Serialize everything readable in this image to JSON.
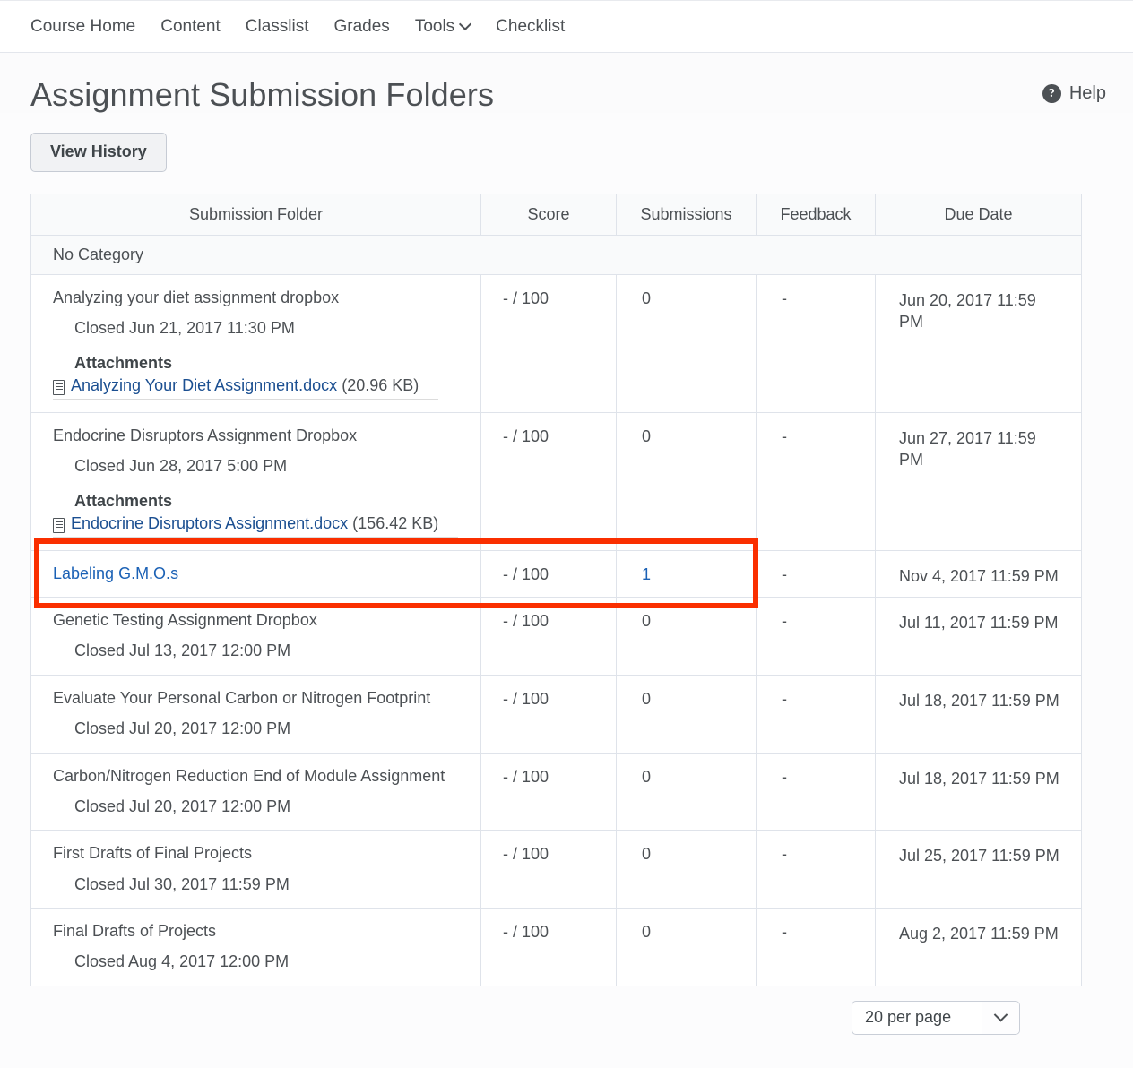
{
  "nav": {
    "items": [
      {
        "label": "Course Home",
        "has_caret": false
      },
      {
        "label": "Content",
        "has_caret": false
      },
      {
        "label": "Classlist",
        "has_caret": false
      },
      {
        "label": "Grades",
        "has_caret": false
      },
      {
        "label": "Tools",
        "has_caret": true
      },
      {
        "label": "Checklist",
        "has_caret": false
      }
    ]
  },
  "header": {
    "title": "Assignment Submission Folders",
    "help_label": "Help",
    "help_icon": "question-circle-icon"
  },
  "toolbar": {
    "view_history_label": "View History"
  },
  "table": {
    "columns": [
      "Submission Folder",
      "Score",
      "Submissions",
      "Feedback",
      "Due Date"
    ],
    "category_label": "No Category",
    "rows": [
      {
        "title": "Analyzing your diet assignment dropbox",
        "is_link": false,
        "closed": "Closed Jun 21, 2017 11:30 PM",
        "attachments_label": "Attachments",
        "attachment_name": "Analyzing Your Diet Assignment.docx",
        "attachment_size": "(20.96 KB)",
        "score": "- / 100",
        "submissions": "0",
        "submissions_is_link": false,
        "feedback": "-",
        "due_date": "Jun 20, 2017 11:59 PM"
      },
      {
        "title": "Endocrine Disruptors Assignment Dropbox",
        "is_link": false,
        "closed": "Closed Jun 28, 2017 5:00 PM",
        "attachments_label": "Attachments",
        "attachment_name": "Endocrine Disruptors Assignment.docx",
        "attachment_size": "(156.42 KB)",
        "score": "- / 100",
        "submissions": "0",
        "submissions_is_link": false,
        "feedback": "-",
        "due_date": "Jun 27, 2017 11:59 PM"
      },
      {
        "title": "Labeling G.M.O.s",
        "is_link": true,
        "closed": "",
        "attachments_label": "",
        "attachment_name": "",
        "attachment_size": "",
        "score": "- / 100",
        "submissions": "1",
        "submissions_is_link": true,
        "feedback": "-",
        "due_date": "Nov 4, 2017 11:59 PM"
      },
      {
        "title": "Genetic Testing Assignment Dropbox",
        "is_link": false,
        "closed": "Closed Jul 13, 2017 12:00 PM",
        "attachments_label": "",
        "attachment_name": "",
        "attachment_size": "",
        "score": "- / 100",
        "submissions": "0",
        "submissions_is_link": false,
        "feedback": "-",
        "due_date": "Jul 11, 2017 11:59 PM"
      },
      {
        "title": "Evaluate Your Personal Carbon or Nitrogen Footprint",
        "is_link": false,
        "closed": "Closed Jul 20, 2017 12:00 PM",
        "attachments_label": "",
        "attachment_name": "",
        "attachment_size": "",
        "score": "- / 100",
        "submissions": "0",
        "submissions_is_link": false,
        "feedback": "-",
        "due_date": "Jul 18, 2017 11:59 PM"
      },
      {
        "title": "Carbon/Nitrogen Reduction End of Module Assignment",
        "is_link": false,
        "closed": "Closed Jul 20, 2017 12:00 PM",
        "attachments_label": "",
        "attachment_name": "",
        "attachment_size": "",
        "score": "- / 100",
        "submissions": "0",
        "submissions_is_link": false,
        "feedback": "-",
        "due_date": "Jul 18, 2017 11:59 PM"
      },
      {
        "title": "First Drafts of Final Projects",
        "is_link": false,
        "closed": "Closed Jul 30, 2017 11:59 PM",
        "attachments_label": "",
        "attachment_name": "",
        "attachment_size": "",
        "score": "- / 100",
        "submissions": "0",
        "submissions_is_link": false,
        "feedback": "-",
        "due_date": "Jul 25, 2017 11:59 PM"
      },
      {
        "title": "Final Drafts of Projects",
        "is_link": false,
        "closed": "Closed Aug 4, 2017 12:00 PM",
        "attachments_label": "",
        "attachment_name": "",
        "attachment_size": "",
        "score": "- / 100",
        "submissions": "0",
        "submissions_is_link": false,
        "feedback": "-",
        "due_date": "Aug 2, 2017 11:59 PM"
      }
    ]
  },
  "footer": {
    "per_page_value": "20 per page",
    "per_page_icon": "chevron-down-icon"
  },
  "annotation": {
    "highlight_color": "#fa2f00",
    "highlighted_row_title": "Labeling G.M.O.s"
  }
}
